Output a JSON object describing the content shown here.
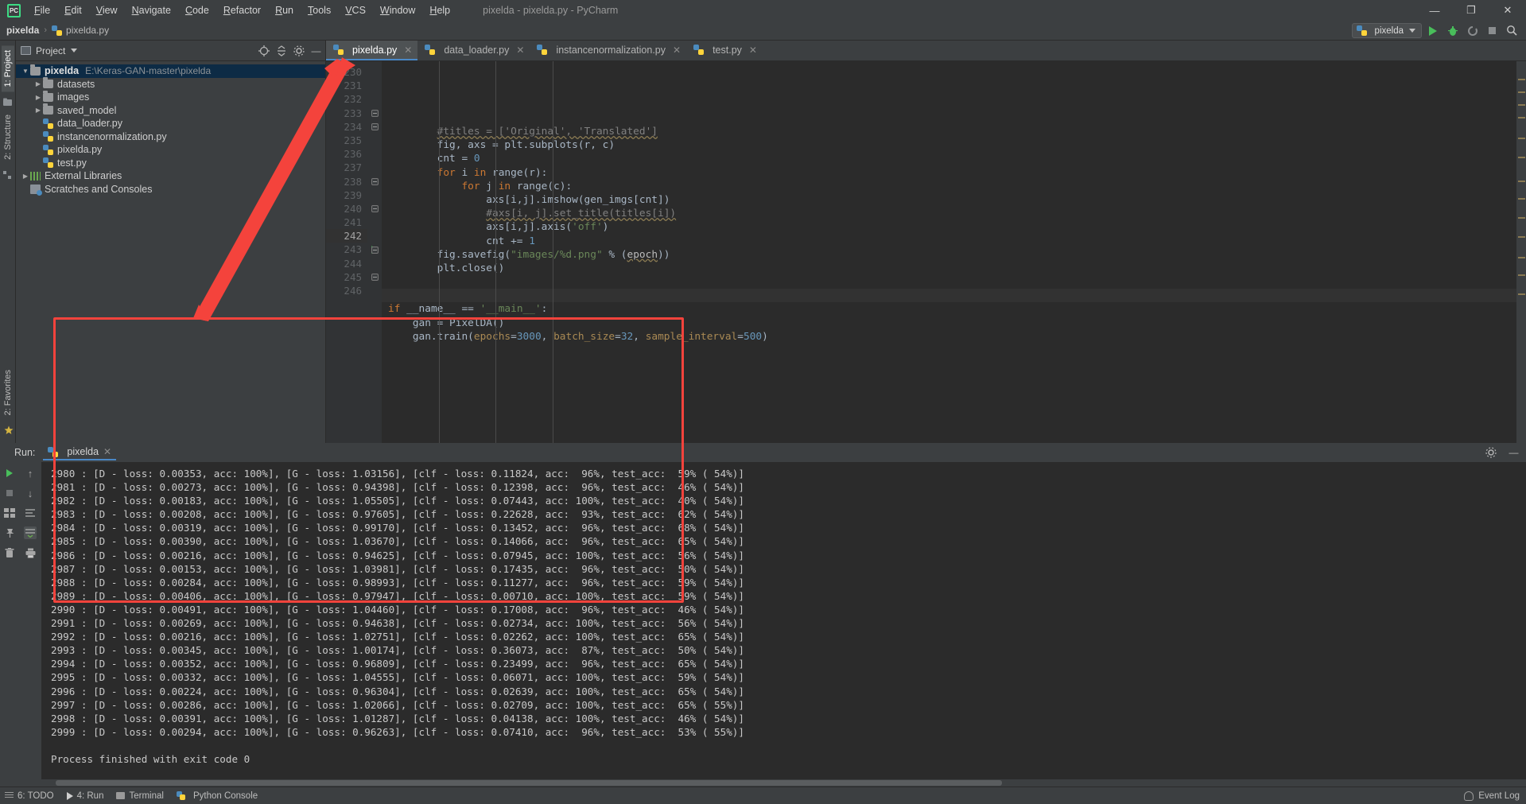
{
  "window": {
    "title": "pixelda - pixelda.py - PyCharm",
    "logo_text": "PC",
    "minimize": "—",
    "maximize": "❐",
    "close": "✕"
  },
  "menubar": {
    "items": [
      "File",
      "Edit",
      "View",
      "Navigate",
      "Code",
      "Refactor",
      "Run",
      "Tools",
      "VCS",
      "Window",
      "Help"
    ]
  },
  "navbar": {
    "project_crumb": "pixelda",
    "separator": "›",
    "file_crumb": "pixelda.py",
    "run_config": "pixelda",
    "icons": [
      "run-icon",
      "debug-icon",
      "coverage-icon",
      "stop-icon",
      "search-icon"
    ]
  },
  "leftstrip": {
    "tabs": [
      {
        "label": "1: Project",
        "name": "tool-window-project",
        "active": true
      },
      {
        "label": "2: Structure",
        "name": "tool-window-structure",
        "active": false
      }
    ],
    "bottom_tabs": [
      {
        "label": "2: Favorites",
        "name": "tool-window-favorites"
      }
    ]
  },
  "project_panel": {
    "title": "Project",
    "header_icons": [
      "target-icon",
      "collapse-all-icon",
      "settings-icon",
      "hide-icon"
    ],
    "tree": [
      {
        "indent": 0,
        "arrow": "▼",
        "icon": "folder-icon",
        "name": "pixelda",
        "bold": true,
        "path": "E:\\Keras-GAN-master\\pixelda",
        "selected": true
      },
      {
        "indent": 1,
        "arrow": "▶",
        "icon": "folder-icon",
        "name": "datasets",
        "bold": false,
        "path": "",
        "selected": false
      },
      {
        "indent": 1,
        "arrow": "▶",
        "icon": "folder-icon",
        "name": "images",
        "bold": false,
        "path": "",
        "selected": false
      },
      {
        "indent": 1,
        "arrow": "▶",
        "icon": "folder-icon",
        "name": "saved_model",
        "bold": false,
        "path": "",
        "selected": false
      },
      {
        "indent": 1,
        "arrow": "",
        "icon": "python-file-icon",
        "name": "data_loader.py",
        "bold": false,
        "path": "",
        "selected": false
      },
      {
        "indent": 1,
        "arrow": "",
        "icon": "python-file-icon",
        "name": "instancenormalization.py",
        "bold": false,
        "path": "",
        "selected": false
      },
      {
        "indent": 1,
        "arrow": "",
        "icon": "python-file-icon",
        "name": "pixelda.py",
        "bold": false,
        "path": "",
        "selected": false
      },
      {
        "indent": 1,
        "arrow": "",
        "icon": "python-file-icon",
        "name": "test.py",
        "bold": false,
        "path": "",
        "selected": false
      },
      {
        "indent": 0,
        "arrow": "▶",
        "icon": "library-icon",
        "name": "External Libraries",
        "bold": false,
        "path": "",
        "selected": false
      },
      {
        "indent": 0,
        "arrow": "",
        "icon": "scratches-icon",
        "name": "Scratches and Consoles",
        "bold": false,
        "path": "",
        "selected": false
      }
    ]
  },
  "editor": {
    "tabs": [
      {
        "label": "pixelda.py",
        "active": true,
        "closable": true
      },
      {
        "label": "data_loader.py",
        "active": false,
        "closable": true
      },
      {
        "label": "instancenormalization.py",
        "active": false,
        "closable": true
      },
      {
        "label": "test.py",
        "active": false,
        "closable": true
      }
    ],
    "first_line_no": 230,
    "lines": [
      {
        "no": 230,
        "fold": "",
        "run": false,
        "cur": false,
        "tokens": [
          {
            "t": "        ",
            "c": "id"
          },
          {
            "t": "#titles = ['Original', 'Translated']",
            "c": "cmt"
          }
        ]
      },
      {
        "no": 231,
        "fold": "",
        "run": false,
        "cur": false,
        "tokens": [
          {
            "t": "        fig, axs = plt.subplots(r, c)",
            "c": "id"
          }
        ]
      },
      {
        "no": 232,
        "fold": "",
        "run": false,
        "cur": false,
        "tokens": [
          {
            "t": "        cnt = ",
            "c": "id"
          },
          {
            "t": "0",
            "c": "num"
          }
        ]
      },
      {
        "no": 233,
        "fold": "fold",
        "run": false,
        "cur": false,
        "tokens": [
          {
            "t": "        ",
            "c": "id"
          },
          {
            "t": "for",
            "c": "kw"
          },
          {
            "t": " i ",
            "c": "id"
          },
          {
            "t": "in",
            "c": "kw"
          },
          {
            "t": " range(r):",
            "c": "id"
          }
        ]
      },
      {
        "no": 234,
        "fold": "fold",
        "run": false,
        "cur": false,
        "tokens": [
          {
            "t": "            ",
            "c": "id"
          },
          {
            "t": "for",
            "c": "kw"
          },
          {
            "t": " j ",
            "c": "id"
          },
          {
            "t": "in",
            "c": "kw"
          },
          {
            "t": " range(c):",
            "c": "id"
          }
        ]
      },
      {
        "no": 235,
        "fold": "",
        "run": false,
        "cur": false,
        "tokens": [
          {
            "t": "                axs[i,j].imshow(gen_imgs[cnt])",
            "c": "id"
          }
        ]
      },
      {
        "no": 236,
        "fold": "",
        "run": false,
        "cur": false,
        "tokens": [
          {
            "t": "                ",
            "c": "id"
          },
          {
            "t": "#axs[i, j].set_title(titles[i])",
            "c": "cmt"
          }
        ]
      },
      {
        "no": 237,
        "fold": "",
        "run": false,
        "cur": false,
        "tokens": [
          {
            "t": "                axs[i,j].axis(",
            "c": "id"
          },
          {
            "t": "'off'",
            "c": "str"
          },
          {
            "t": ")",
            "c": "id"
          }
        ]
      },
      {
        "no": 238,
        "fold": "fold",
        "run": false,
        "cur": false,
        "tokens": [
          {
            "t": "                cnt += ",
            "c": "id"
          },
          {
            "t": "1",
            "c": "num"
          }
        ]
      },
      {
        "no": 239,
        "fold": "",
        "run": false,
        "cur": false,
        "tokens": [
          {
            "t": "        fig.savefig(",
            "c": "id"
          },
          {
            "t": "\"images/%d.png\"",
            "c": "str"
          },
          {
            "t": " % (",
            "c": "id"
          },
          {
            "t": "epoch",
            "c": "warnu"
          },
          {
            "t": "))",
            "c": "id"
          }
        ]
      },
      {
        "no": 240,
        "fold": "fold",
        "run": false,
        "cur": false,
        "tokens": [
          {
            "t": "        plt.close()",
            "c": "id"
          }
        ]
      },
      {
        "no": 241,
        "fold": "",
        "run": false,
        "cur": false,
        "tokens": [
          {
            "t": "",
            "c": "id"
          }
        ]
      },
      {
        "no": 242,
        "fold": "",
        "run": false,
        "cur": true,
        "tokens": [
          {
            "t": "",
            "c": "id"
          }
        ]
      },
      {
        "no": 243,
        "fold": "fold",
        "run": true,
        "cur": false,
        "tokens": [
          {
            "t": "if",
            "c": "kw"
          },
          {
            "t": " __name__ == ",
            "c": "id"
          },
          {
            "t": "'__main__'",
            "c": "str"
          },
          {
            "t": ":",
            "c": "id"
          }
        ]
      },
      {
        "no": 244,
        "fold": "",
        "run": false,
        "cur": false,
        "tokens": [
          {
            "t": "    gan = PixelDA()",
            "c": "id"
          }
        ]
      },
      {
        "no": 245,
        "fold": "fold",
        "run": false,
        "cur": false,
        "tokens": [
          {
            "t": "    gan.train(",
            "c": "id"
          },
          {
            "t": "epochs",
            "c": "kwarg"
          },
          {
            "t": "=",
            "c": "id"
          },
          {
            "t": "3000",
            "c": "num"
          },
          {
            "t": ", ",
            "c": "id"
          },
          {
            "t": "batch_size",
            "c": "kwarg"
          },
          {
            "t": "=",
            "c": "id"
          },
          {
            "t": "32",
            "c": "num"
          },
          {
            "t": ", ",
            "c": "id"
          },
          {
            "t": "sample_interval",
            "c": "kwarg"
          },
          {
            "t": "=",
            "c": "id"
          },
          {
            "t": "500",
            "c": "num"
          },
          {
            "t": ")",
            "c": "id"
          }
        ]
      },
      {
        "no": 246,
        "fold": "",
        "run": false,
        "cur": false,
        "tokens": [
          {
            "t": "",
            "c": "id"
          }
        ]
      }
    ]
  },
  "run_panel": {
    "label": "Run:",
    "tab_name": "pixelda",
    "toolbar_icons": [
      "rerun-icon",
      "stop-icon",
      "layout-icon",
      "pin-icon",
      "trash-icon"
    ],
    "toolbar2_icons": [
      "scroll-up-icon",
      "scroll-down-icon",
      "soft-wrap-icon",
      "scroll-to-end-icon",
      "print-icon"
    ],
    "header_icons": [
      "settings-icon",
      "hide-icon"
    ],
    "console_lines": [
      "2980 : [D - loss: 0.00353, acc: 100%], [G - loss: 1.03156], [clf - loss: 0.11824, acc:  96%, test_acc:  59% ( 54%)]",
      "2981 : [D - loss: 0.00273, acc: 100%], [G - loss: 0.94398], [clf - loss: 0.12398, acc:  96%, test_acc:  46% ( 54%)]",
      "2982 : [D - loss: 0.00183, acc: 100%], [G - loss: 1.05505], [clf - loss: 0.07443, acc: 100%, test_acc:  40% ( 54%)]",
      "2983 : [D - loss: 0.00208, acc: 100%], [G - loss: 0.97605], [clf - loss: 0.22628, acc:  93%, test_acc:  62% ( 54%)]",
      "2984 : [D - loss: 0.00319, acc: 100%], [G - loss: 0.99170], [clf - loss: 0.13452, acc:  96%, test_acc:  68% ( 54%)]",
      "2985 : [D - loss: 0.00390, acc: 100%], [G - loss: 1.03670], [clf - loss: 0.14066, acc:  96%, test_acc:  65% ( 54%)]",
      "2986 : [D - loss: 0.00216, acc: 100%], [G - loss: 0.94625], [clf - loss: 0.07945, acc: 100%, test_acc:  56% ( 54%)]",
      "2987 : [D - loss: 0.00153, acc: 100%], [G - loss: 1.03981], [clf - loss: 0.17435, acc:  96%, test_acc:  50% ( 54%)]",
      "2988 : [D - loss: 0.00284, acc: 100%], [G - loss: 0.98993], [clf - loss: 0.11277, acc:  96%, test_acc:  59% ( 54%)]",
      "2989 : [D - loss: 0.00406, acc: 100%], [G - loss: 0.97947], [clf - loss: 0.00710, acc: 100%, test_acc:  59% ( 54%)]",
      "2990 : [D - loss: 0.00491, acc: 100%], [G - loss: 1.04460], [clf - loss: 0.17008, acc:  96%, test_acc:  46% ( 54%)]",
      "2991 : [D - loss: 0.00269, acc: 100%], [G - loss: 0.94638], [clf - loss: 0.02734, acc: 100%, test_acc:  56% ( 54%)]",
      "2992 : [D - loss: 0.00216, acc: 100%], [G - loss: 1.02751], [clf - loss: 0.02262, acc: 100%, test_acc:  65% ( 54%)]",
      "2993 : [D - loss: 0.00345, acc: 100%], [G - loss: 1.00174], [clf - loss: 0.36073, acc:  87%, test_acc:  50% ( 54%)]",
      "2994 : [D - loss: 0.00352, acc: 100%], [G - loss: 0.96809], [clf - loss: 0.23499, acc:  96%, test_acc:  65% ( 54%)]",
      "2995 : [D - loss: 0.00332, acc: 100%], [G - loss: 1.04555], [clf - loss: 0.06071, acc: 100%, test_acc:  59% ( 54%)]",
      "2996 : [D - loss: 0.00224, acc: 100%], [G - loss: 0.96304], [clf - loss: 0.02639, acc: 100%, test_acc:  65% ( 54%)]",
      "2997 : [D - loss: 0.00286, acc: 100%], [G - loss: 1.02066], [clf - loss: 0.02709, acc: 100%, test_acc:  65% ( 55%)]",
      "2998 : [D - loss: 0.00391, acc: 100%], [G - loss: 1.01287], [clf - loss: 0.04138, acc: 100%, test_acc:  46% ( 54%)]",
      "2999 : [D - loss: 0.00294, acc: 100%], [G - loss: 0.96263], [clf - loss: 0.07410, acc:  96%, test_acc:  53% ( 55%)]"
    ],
    "finish_message": "Process finished with exit code 0"
  },
  "statusbar": {
    "items": [
      {
        "label": "6: TODO",
        "icon": "todo-icon"
      },
      {
        "label": "4: Run",
        "icon": "run-icon"
      },
      {
        "label": "Terminal",
        "icon": "terminal-icon"
      },
      {
        "label": "Python Console",
        "icon": "python-icon"
      }
    ],
    "event_log": "Event Log"
  },
  "annotation": {
    "accent_color": "#f4433c",
    "description": "red-arrow-pointing-from-console-to-editor-tab"
  }
}
